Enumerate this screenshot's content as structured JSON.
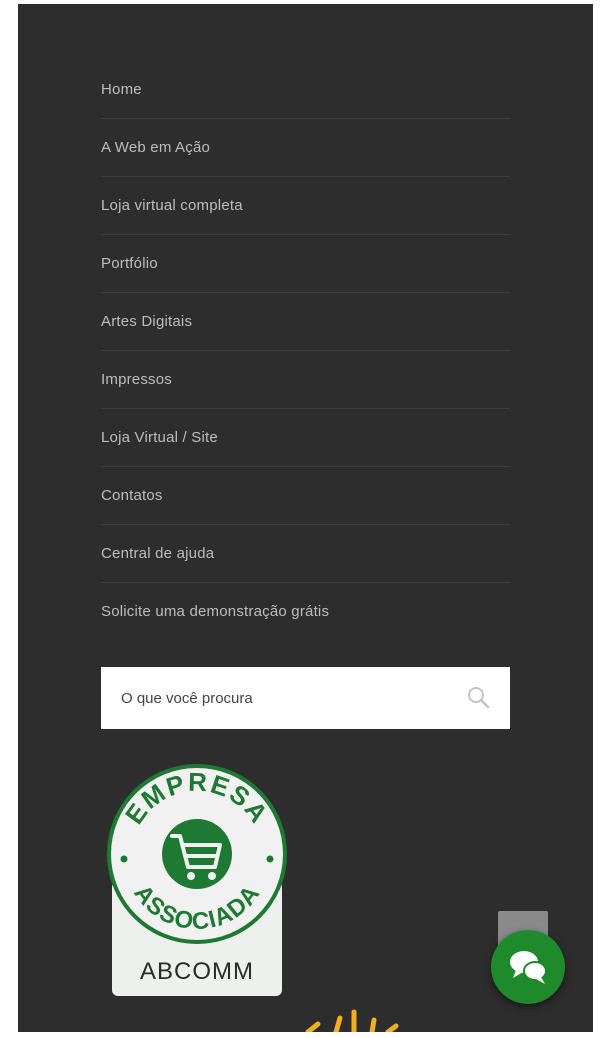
{
  "nav": {
    "items": [
      {
        "label": "Home"
      },
      {
        "label": "A Web em Ação"
      },
      {
        "label": "Loja virtual completa"
      },
      {
        "label": "Portfólio"
      },
      {
        "label": "Artes Digitais"
      },
      {
        "label": "Impressos"
      },
      {
        "label": "Loja Virtual / Site"
      },
      {
        "label": "Contatos"
      },
      {
        "label": "Central de ajuda"
      },
      {
        "label": "Solicite uma demonstração grátis"
      }
    ]
  },
  "search": {
    "placeholder": "O que você procura",
    "icon": "search-icon"
  },
  "badge": {
    "top_text": "EMPRESA",
    "bottom_text": "ASSOCIADA",
    "brand": "ABCOMM",
    "icon": "shopping-cart-icon"
  },
  "chat": {
    "icon": "chat-bubbles-icon"
  },
  "colors": {
    "panel_bg": "#2d2d2d",
    "nav_text": "#bdbdbd",
    "badge_green": "#1e7a32",
    "chat_green": "#1f8a2c",
    "accent_yellow": "#f2b01e"
  }
}
